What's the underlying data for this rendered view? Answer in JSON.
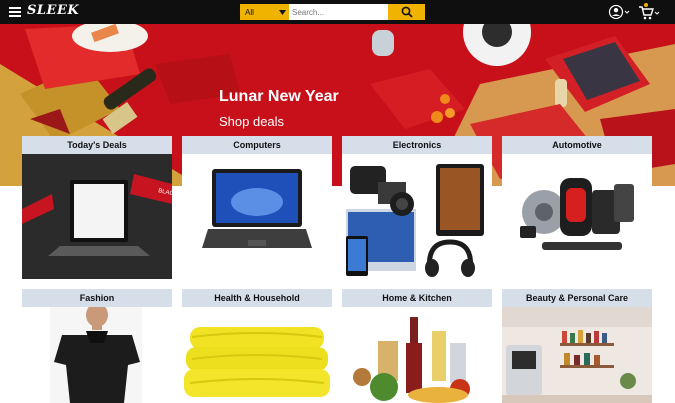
{
  "header": {
    "brand": "SLEEK",
    "search": {
      "category": "All",
      "placeholder": "Search..."
    }
  },
  "hero": {
    "title": "Lunar New Year",
    "subtitle": "Shop deals"
  },
  "categories": [
    {
      "label": "Today's Deals",
      "image_text": "BLACK FRIDAY"
    },
    {
      "label": "Computers"
    },
    {
      "label": "Electronics"
    },
    {
      "label": "Automotive"
    },
    {
      "label": "Fashion"
    },
    {
      "label": "Health & Household"
    },
    {
      "label": "Home & Kitchen"
    },
    {
      "label": "Beauty & Personal Care"
    }
  ],
  "colors": {
    "topbar": "#0f0f0f",
    "accent": "#f0b400",
    "hero": "#c8101a",
    "card_header": "#d6deea"
  },
  "icons": [
    "menu-icon",
    "search-icon",
    "account-icon",
    "cart-icon",
    "chevron-down-icon"
  ]
}
